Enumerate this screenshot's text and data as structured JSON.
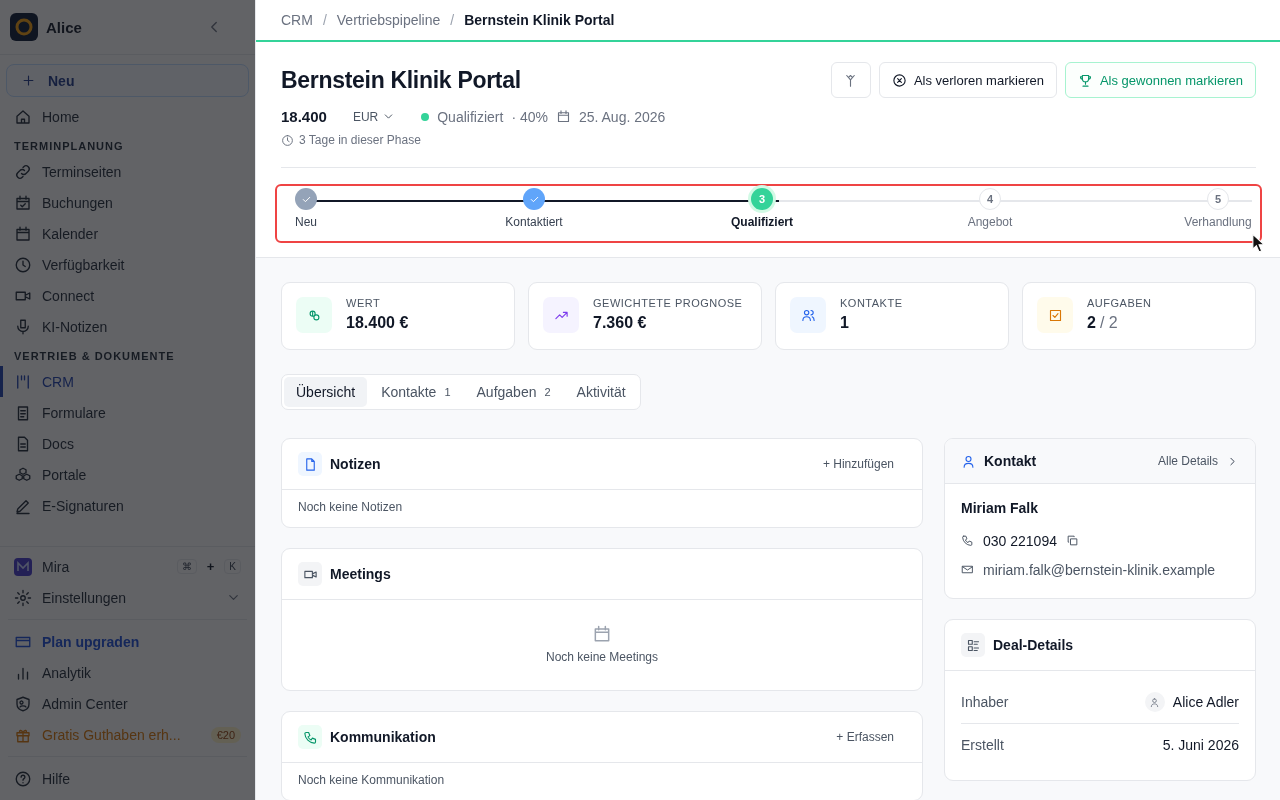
{
  "sidebar": {
    "workspace": "Alice",
    "new_button": "Neu",
    "nav": [
      {
        "kind": "link",
        "label": "Home",
        "selected": false
      },
      {
        "kind": "heading",
        "label": "TERMINPLANUNG"
      },
      {
        "kind": "link",
        "label": "Terminseiten",
        "selected": false
      },
      {
        "kind": "link",
        "label": "Buchungen",
        "selected": false
      },
      {
        "kind": "link",
        "label": "Kalender",
        "selected": false
      },
      {
        "kind": "link",
        "label": "Verfügbarkeit",
        "selected": false
      },
      {
        "kind": "link",
        "label": "Connect",
        "selected": false
      },
      {
        "kind": "link",
        "label": "KI-Notizen",
        "selected": false
      },
      {
        "kind": "heading",
        "label": "VERTRIEB & DOKUMENTE"
      },
      {
        "kind": "link",
        "label": "CRM",
        "selected": true
      },
      {
        "kind": "link",
        "label": "Formulare",
        "selected": false
      },
      {
        "kind": "link",
        "label": "Docs",
        "selected": false
      },
      {
        "kind": "link",
        "label": "Portale",
        "selected": false
      },
      {
        "kind": "link",
        "label": "E-Signaturen",
        "selected": false
      }
    ],
    "assistant": {
      "label": "Mira",
      "shortcut": [
        "⌘",
        "+",
        "K"
      ]
    },
    "settings": {
      "label": "Einstellungen",
      "expanded": false
    },
    "footer": [
      {
        "kind": "accent",
        "label": "Plan upgraden"
      },
      {
        "kind": "link",
        "label": "Analytik"
      },
      {
        "kind": "link",
        "label": "Admin Center"
      },
      {
        "kind": "promo",
        "label": "Gratis Guthaben erh...",
        "badge": "€20"
      },
      {
        "kind": "divider"
      },
      {
        "kind": "link",
        "label": "Hilfe"
      }
    ]
  },
  "breadcrumb": [
    "CRM",
    "Vertriebspipeline",
    "Bernstein Klinik Portal"
  ],
  "breadcrumb_separator": "/",
  "deal": {
    "title": "Bernstein Klinik Portal",
    "amount": "18.400",
    "currency": "EUR",
    "stage": "Qualifiziert",
    "probability": "· 40%",
    "close_date": "25. Aug. 2026",
    "phase_time": "3 Tage in dieser Phase",
    "actions": [
      {
        "kind": "icon"
      },
      {
        "kind": "lost",
        "label": "Als verloren markieren"
      },
      {
        "kind": "won",
        "label": "Als gewonnen markieren"
      }
    ]
  },
  "stages": [
    {
      "label": "Neu",
      "completed": true,
      "selected": false
    },
    {
      "label": "Kontaktiert",
      "completed": true,
      "selected": false
    },
    {
      "label": "Qualifiziert",
      "number": "3",
      "completed": false,
      "selected": true
    },
    {
      "label": "Angebot",
      "number": "4",
      "completed": false,
      "selected": false
    },
    {
      "label": "Verhandlung",
      "number": "5",
      "completed": false,
      "selected": false
    }
  ],
  "stats": [
    {
      "kind": "value",
      "label": "WERT",
      "value": "18.400 €"
    },
    {
      "kind": "forecast",
      "label": "GEWICHTETE PROGNOSE",
      "value": "7.360 €"
    },
    {
      "kind": "contacts",
      "label": "KONTAKTE",
      "value": "1"
    },
    {
      "kind": "tasks",
      "label": "AUFGABEN",
      "value": "2",
      "total": "/ 2"
    }
  ],
  "tabs": [
    {
      "label": "Übersicht",
      "selected": true
    },
    {
      "label": "Kontakte",
      "count": "1",
      "selected": false
    },
    {
      "label": "Aufgaben",
      "count": "2",
      "selected": false
    },
    {
      "label": "Aktivität",
      "selected": false
    }
  ],
  "sections": [
    {
      "kind": "notes",
      "title": "Notizen",
      "action": "+ Hinzufügen",
      "empty": "Noch keine Notizen"
    },
    {
      "kind": "meetings",
      "title": "Meetings",
      "empty": "Noch keine Meetings"
    },
    {
      "kind": "communication",
      "title": "Kommunikation",
      "action": "+ Erfassen",
      "empty": "Noch keine Kommunikation"
    }
  ],
  "contact": {
    "title": "Kontakt",
    "link": "Alle Details",
    "name": "Miriam Falk",
    "phone": "030 221094",
    "email": "miriam.falk@bernstein-klinik.example"
  },
  "details": {
    "title": "Deal-Details",
    "rows": [
      {
        "label": "Inhaber",
        "value": "Alice Adler",
        "kind": "user"
      },
      {
        "label": "Erstellt",
        "value": "5. Juni 2026",
        "kind": "text"
      }
    ]
  }
}
